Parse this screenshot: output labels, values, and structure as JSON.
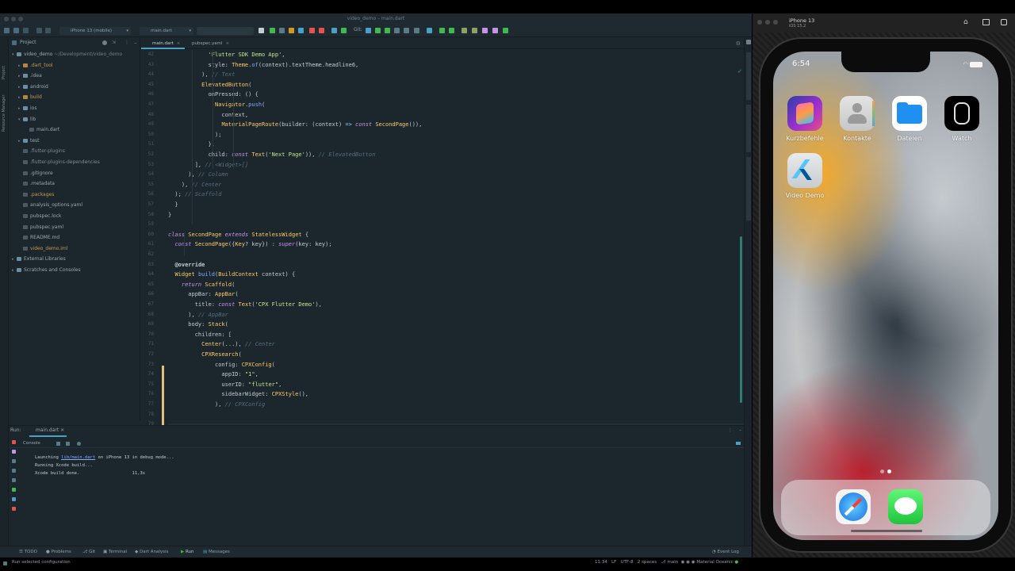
{
  "ide": {
    "window_title": "video_demo – main.dart",
    "device_selector": "iPhone 13 (mobile)",
    "config_selector": "main.dart",
    "project_label": "Project",
    "left_stripe_labels": [
      "Project",
      "Resource Manager"
    ],
    "tree": [
      {
        "label": "video_demo",
        "suffix": " ~/Development/video_demo",
        "depth": 0,
        "color": "#9aa9b0"
      },
      {
        "label": ".dart_tool",
        "depth": 1,
        "color": "#c59a52"
      },
      {
        "label": ".idea",
        "depth": 1,
        "color": "#9aa9b0"
      },
      {
        "label": "android",
        "depth": 1,
        "color": "#9aa9b0"
      },
      {
        "label": "build",
        "depth": 1,
        "color": "#c59a52"
      },
      {
        "label": "ios",
        "depth": 1,
        "color": "#9aa9b0"
      },
      {
        "label": "lib",
        "depth": 1,
        "color": "#9aa9b0"
      },
      {
        "label": "main.dart",
        "depth": 2,
        "color": "#9aa9b0"
      },
      {
        "label": "test",
        "depth": 1,
        "color": "#9aa9b0"
      },
      {
        "label": ".flutter-plugins",
        "depth": 1,
        "color": "#7d8c94"
      },
      {
        "label": ".flutter-plugins-dependencies",
        "depth": 1,
        "color": "#7d8c94"
      },
      {
        "label": ".gitignore",
        "depth": 1,
        "color": "#9aa9b0"
      },
      {
        "label": ".metadata",
        "depth": 1,
        "color": "#9aa9b0"
      },
      {
        "label": ".packages",
        "depth": 1,
        "color": "#c59a52"
      },
      {
        "label": "analysis_options.yaml",
        "depth": 1,
        "color": "#9aa9b0"
      },
      {
        "label": "pubspec.lock",
        "depth": 1,
        "color": "#9aa9b0"
      },
      {
        "label": "pubspec.yaml",
        "depth": 1,
        "color": "#9aa9b0"
      },
      {
        "label": "README.md",
        "depth": 1,
        "color": "#9aa9b0"
      },
      {
        "label": "video_demo.iml",
        "depth": 1,
        "color": "#c59a52"
      },
      {
        "label": "External Libraries",
        "depth": 0,
        "color": "#9aa9b0"
      },
      {
        "label": "Scratches and Consoles",
        "depth": 0,
        "color": "#9aa9b0"
      }
    ],
    "tabs": [
      {
        "label": "main.dart",
        "active": true
      },
      {
        "label": "pubspec.yaml",
        "active": false
      }
    ],
    "line_numbers": [
      "42",
      "43",
      "44",
      "45",
      "46",
      "47",
      "48",
      "49",
      "50",
      "51",
      "52",
      "53",
      "54",
      "55",
      "56",
      "57",
      "58",
      "59",
      "60",
      "61",
      "62",
      "63",
      "64",
      "65",
      "66",
      "67",
      "68",
      "69",
      "70",
      "71",
      "72",
      "73",
      "74",
      "75",
      "76",
      "77",
      "78",
      "79",
      "80",
      "81"
    ],
    "code_lines": [
      [
        {
          "t": "            "
        },
        {
          "t": "'Flutter SDK Demo App'",
          "c": "st"
        },
        {
          "t": ","
        }
      ],
      [
        {
          "t": "            style: "
        },
        {
          "t": "Theme",
          "c": "ty"
        },
        {
          "t": "."
        },
        {
          "t": "of",
          "c": "fn"
        },
        {
          "t": "(context).textTheme.headline6,"
        }
      ],
      [
        {
          "t": "          ), "
        },
        {
          "t": "// Text",
          "c": "cm"
        }
      ],
      [
        {
          "t": "          "
        },
        {
          "t": "ElevatedButton",
          "c": "ty"
        },
        {
          "t": "("
        }
      ],
      [
        {
          "t": "            onPressed: () {"
        }
      ],
      [
        {
          "t": "              "
        },
        {
          "t": "Navigator",
          "c": "ty"
        },
        {
          "t": "."
        },
        {
          "t": "push",
          "c": "fn"
        },
        {
          "t": "("
        }
      ],
      [
        {
          "t": "                context,"
        }
      ],
      [
        {
          "t": "                "
        },
        {
          "t": "MaterialPageRoute",
          "c": "ty"
        },
        {
          "t": "(builder: (context) "
        },
        {
          "t": "=>",
          "c": "pn"
        },
        {
          "t": " "
        },
        {
          "t": "const",
          "c": "kw"
        },
        {
          "t": " "
        },
        {
          "t": "SecondPage",
          "c": "ty"
        },
        {
          "t": "()),"
        }
      ],
      [
        {
          "t": "              );"
        }
      ],
      [
        {
          "t": "            },"
        }
      ],
      [
        {
          "t": "            child: "
        },
        {
          "t": "const",
          "c": "kw"
        },
        {
          "t": " "
        },
        {
          "t": "Text",
          "c": "ty"
        },
        {
          "t": "("
        },
        {
          "t": "'Next Page'",
          "c": "st"
        },
        {
          "t": ")), "
        },
        {
          "t": "// ElevatedButton",
          "c": "cm"
        }
      ],
      [
        {
          "t": "        ], "
        },
        {
          "t": "// <Widget>[]",
          "c": "cm"
        }
      ],
      [
        {
          "t": "      ), "
        },
        {
          "t": "// Column",
          "c": "cm"
        }
      ],
      [
        {
          "t": "    ), "
        },
        {
          "t": "// Center",
          "c": "cm"
        }
      ],
      [
        {
          "t": "  ); "
        },
        {
          "t": "// Scaffold",
          "c": "cm"
        }
      ],
      [
        {
          "t": "  }"
        }
      ],
      [
        {
          "t": "}"
        }
      ],
      [
        {
          "t": ""
        }
      ],
      [
        {
          "t": "class",
          "c": "kw"
        },
        {
          "t": " "
        },
        {
          "t": "SecondPage",
          "c": "ty"
        },
        {
          "t": " "
        },
        {
          "t": "extends",
          "c": "kw"
        },
        {
          "t": " "
        },
        {
          "t": "StatelessWidget",
          "c": "ty"
        },
        {
          "t": " {"
        }
      ],
      [
        {
          "t": "  "
        },
        {
          "t": "const",
          "c": "kw"
        },
        {
          "t": " "
        },
        {
          "t": "SecondPage",
          "c": "ty"
        },
        {
          "t": "({"
        },
        {
          "t": "Key",
          "c": "ty"
        },
        {
          "t": "? key}) : "
        },
        {
          "t": "super",
          "c": "kw"
        },
        {
          "t": "(key: key);"
        }
      ],
      [
        {
          "t": ""
        }
      ],
      [
        {
          "t": "  "
        },
        {
          "t": "@override",
          "c": "an"
        }
      ],
      [
        {
          "t": "  "
        },
        {
          "t": "Widget",
          "c": "ty"
        },
        {
          "t": " "
        },
        {
          "t": "build",
          "c": "fn"
        },
        {
          "t": "("
        },
        {
          "t": "BuildContext",
          "c": "ty"
        },
        {
          "t": " context) {"
        }
      ],
      [
        {
          "t": "    "
        },
        {
          "t": "return",
          "c": "kw"
        },
        {
          "t": " "
        },
        {
          "t": "Scaffold",
          "c": "ty"
        },
        {
          "t": "("
        }
      ],
      [
        {
          "t": "      appBar: "
        },
        {
          "t": "AppBar",
          "c": "ty"
        },
        {
          "t": "("
        }
      ],
      [
        {
          "t": "        title: "
        },
        {
          "t": "const",
          "c": "kw"
        },
        {
          "t": " "
        },
        {
          "t": "Text",
          "c": "ty"
        },
        {
          "t": "("
        },
        {
          "t": "'CPX Flutter Demo'",
          "c": "st"
        },
        {
          "t": "),"
        }
      ],
      [
        {
          "t": "      ), "
        },
        {
          "t": "// AppBar",
          "c": "cm"
        }
      ],
      [
        {
          "t": "      body: "
        },
        {
          "t": "Stack",
          "c": "ty"
        },
        {
          "t": "("
        }
      ],
      [
        {
          "t": "        children: ["
        }
      ],
      [
        {
          "t": "          "
        },
        {
          "t": "Center",
          "c": "ty"
        },
        {
          "t": "(...), "
        },
        {
          "t": "// Center",
          "c": "cm"
        }
      ],
      [
        {
          "t": "          "
        },
        {
          "t": "CPXResearch",
          "c": "ty"
        },
        {
          "t": "("
        }
      ],
      [
        {
          "t": "              config: "
        },
        {
          "t": "CPXConfig",
          "c": "ty"
        },
        {
          "t": "("
        }
      ],
      [
        {
          "t": "                appID: "
        },
        {
          "t": "\"1\"",
          "c": "st"
        },
        {
          "t": ","
        }
      ],
      [
        {
          "t": "                userID: "
        },
        {
          "t": "\"flutter\"",
          "c": "st"
        },
        {
          "t": ","
        }
      ],
      [
        {
          "t": "                sidebarWidget: "
        },
        {
          "t": "CPXStyle",
          "c": "ty"
        },
        {
          "t": "(),"
        }
      ],
      [
        {
          "t": "              ), "
        },
        {
          "t": "// CPXConfig",
          "c": "cm"
        }
      ]
    ],
    "run": {
      "label": "Run:",
      "tab": "main.dart",
      "console_tab": "Console",
      "lines": [
        {
          "pre": "Launching ",
          "link": "lib/main.dart",
          "post": " on iPhone 13 in debug mode..."
        },
        {
          "pre": "Running Xcode build...",
          "link": "",
          "post": ""
        },
        {
          "pre": "Xcode build done.                    11,3s",
          "link": "",
          "post": ""
        }
      ]
    },
    "bottom_tools": [
      "TODO",
      "Problems",
      "Git",
      "Terminal",
      "Dart Analysis",
      "Run",
      "Messages"
    ],
    "event_log": "Event Log",
    "status_left": "Run selected configuration",
    "status_right": {
      "position": "11:34",
      "line_sep": "LF",
      "encoding": "UTF-8",
      "indent": "2 spaces",
      "branch": "main",
      "theme": "Material Oceanic"
    }
  },
  "simulator": {
    "device": "iPhone 13",
    "os": "iOS 15.2",
    "time": "6:54",
    "apps": [
      {
        "label": "Kurzbefehle",
        "icon": "shortcuts-icon"
      },
      {
        "label": "Kontakte",
        "icon": "contacts-icon"
      },
      {
        "label": "Dateien",
        "icon": "files-icon"
      },
      {
        "label": "Watch",
        "icon": "watch-icon"
      },
      {
        "label": "Video Demo",
        "icon": "flutter-icon"
      }
    ],
    "dock": [
      {
        "icon": "safari-icon"
      },
      {
        "icon": "messages-icon"
      }
    ],
    "colors": {
      "accent": "#4aa0c6",
      "run_green": "#3fb950",
      "stop_red": "#e5534b"
    }
  }
}
